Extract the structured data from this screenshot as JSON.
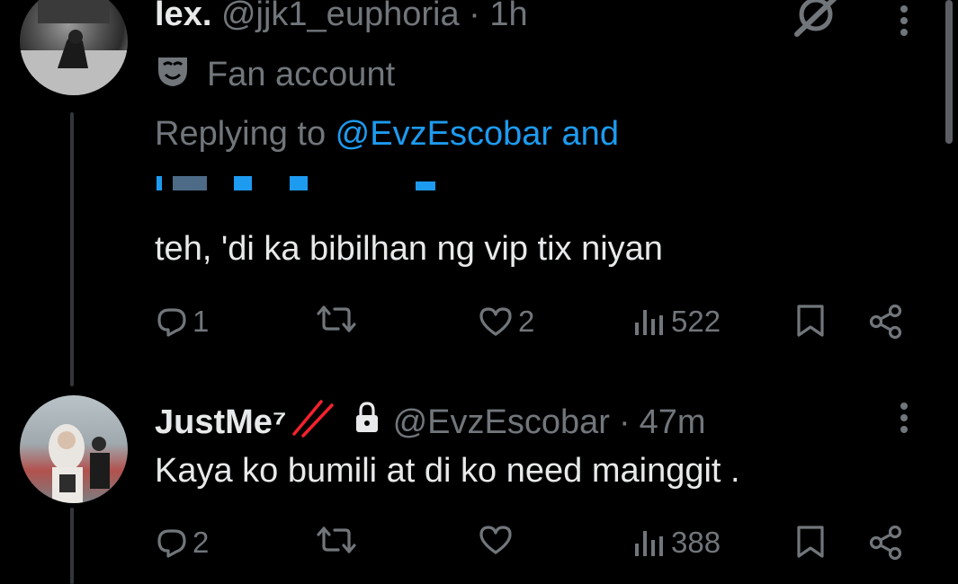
{
  "tweet1": {
    "name": "lex.",
    "handle": "@jjk1_euphoria",
    "dot": "·",
    "time": "1h",
    "badge_label": "Fan account",
    "replying_prefix": "Replying to ",
    "replying_to": "@EvzEscobar and",
    "text": "teh, 'di ka bibilhan ng vip tix niyan",
    "replies": "1",
    "likes": "2",
    "views": "522",
    "icons": [
      "grok-icon",
      "more-icon",
      "mask-icon",
      "reply-icon",
      "retweet-icon",
      "like-icon",
      "views-icon",
      "bookmark-icon",
      "share-icon"
    ]
  },
  "tweet2": {
    "name": "JustMe⁷",
    "handle": "@EvzEscobar",
    "dot": "·",
    "time": "47m",
    "text": "Kaya ko bumili at di ko need mainggit .",
    "replies": "2",
    "views": "388",
    "icons": [
      "slash-emoji-icon",
      "lock-icon",
      "more-icon",
      "reply-icon",
      "retweet-icon",
      "like-icon",
      "views-icon",
      "bookmark-icon",
      "share-icon"
    ]
  },
  "colors": {
    "background": "#000000",
    "text": "#e7e9ea",
    "muted": "#71767b",
    "link": "#1d9bf0",
    "accent_red": "#f4212e"
  }
}
